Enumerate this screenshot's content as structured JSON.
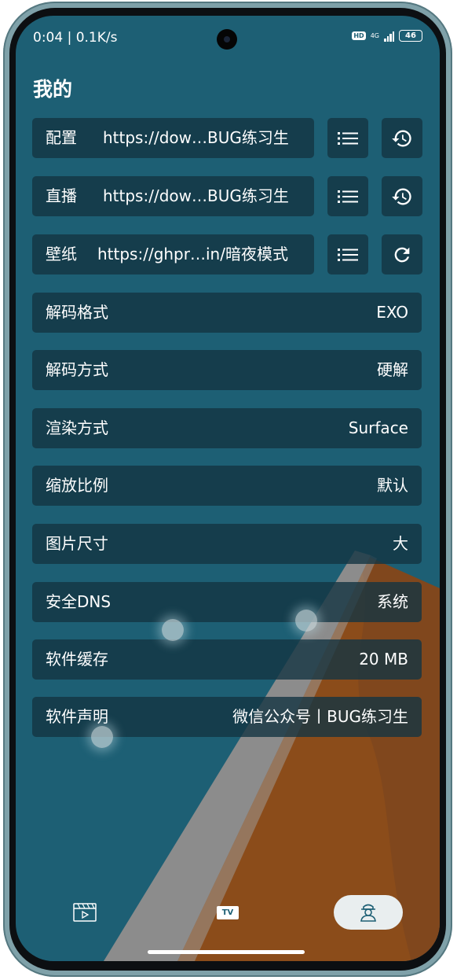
{
  "status": {
    "time_speed": "0:04 | 0.1K/s",
    "hd": "HD",
    "network": "4G",
    "battery": "46"
  },
  "page_title": "我的",
  "source_rows": [
    {
      "label": "配置",
      "url": "https://dow…BUG练习生",
      "action_icon": "history-icon"
    },
    {
      "label": "直播",
      "url": "https://dow…BUG练习生",
      "action_icon": "history-icon"
    },
    {
      "label": "壁纸",
      "url": "https://ghpr…in/暗夜模式",
      "action_icon": "refresh-icon"
    }
  ],
  "settings": [
    {
      "label": "解码格式",
      "value": "EXO"
    },
    {
      "label": "解码方式",
      "value": "硬解"
    },
    {
      "label": "渲染方式",
      "value": "Surface"
    },
    {
      "label": "缩放比例",
      "value": "默认"
    },
    {
      "label": "图片尺寸",
      "value": "大"
    },
    {
      "label": "安全DNS",
      "value": "系统"
    },
    {
      "label": "软件缓存",
      "value": "20 MB"
    },
    {
      "label": "软件声明",
      "value": "微信公众号丨BUG练习生"
    }
  ],
  "nav": {
    "vod_icon": "film-icon",
    "tv_label": "TV",
    "mine_icon": "user-icon",
    "active": "mine"
  },
  "colors": {
    "background": "#1d5f74",
    "row": "#143442",
    "accent_orange": "#8b4c1a",
    "accent_gray": "#8c8c8c"
  }
}
